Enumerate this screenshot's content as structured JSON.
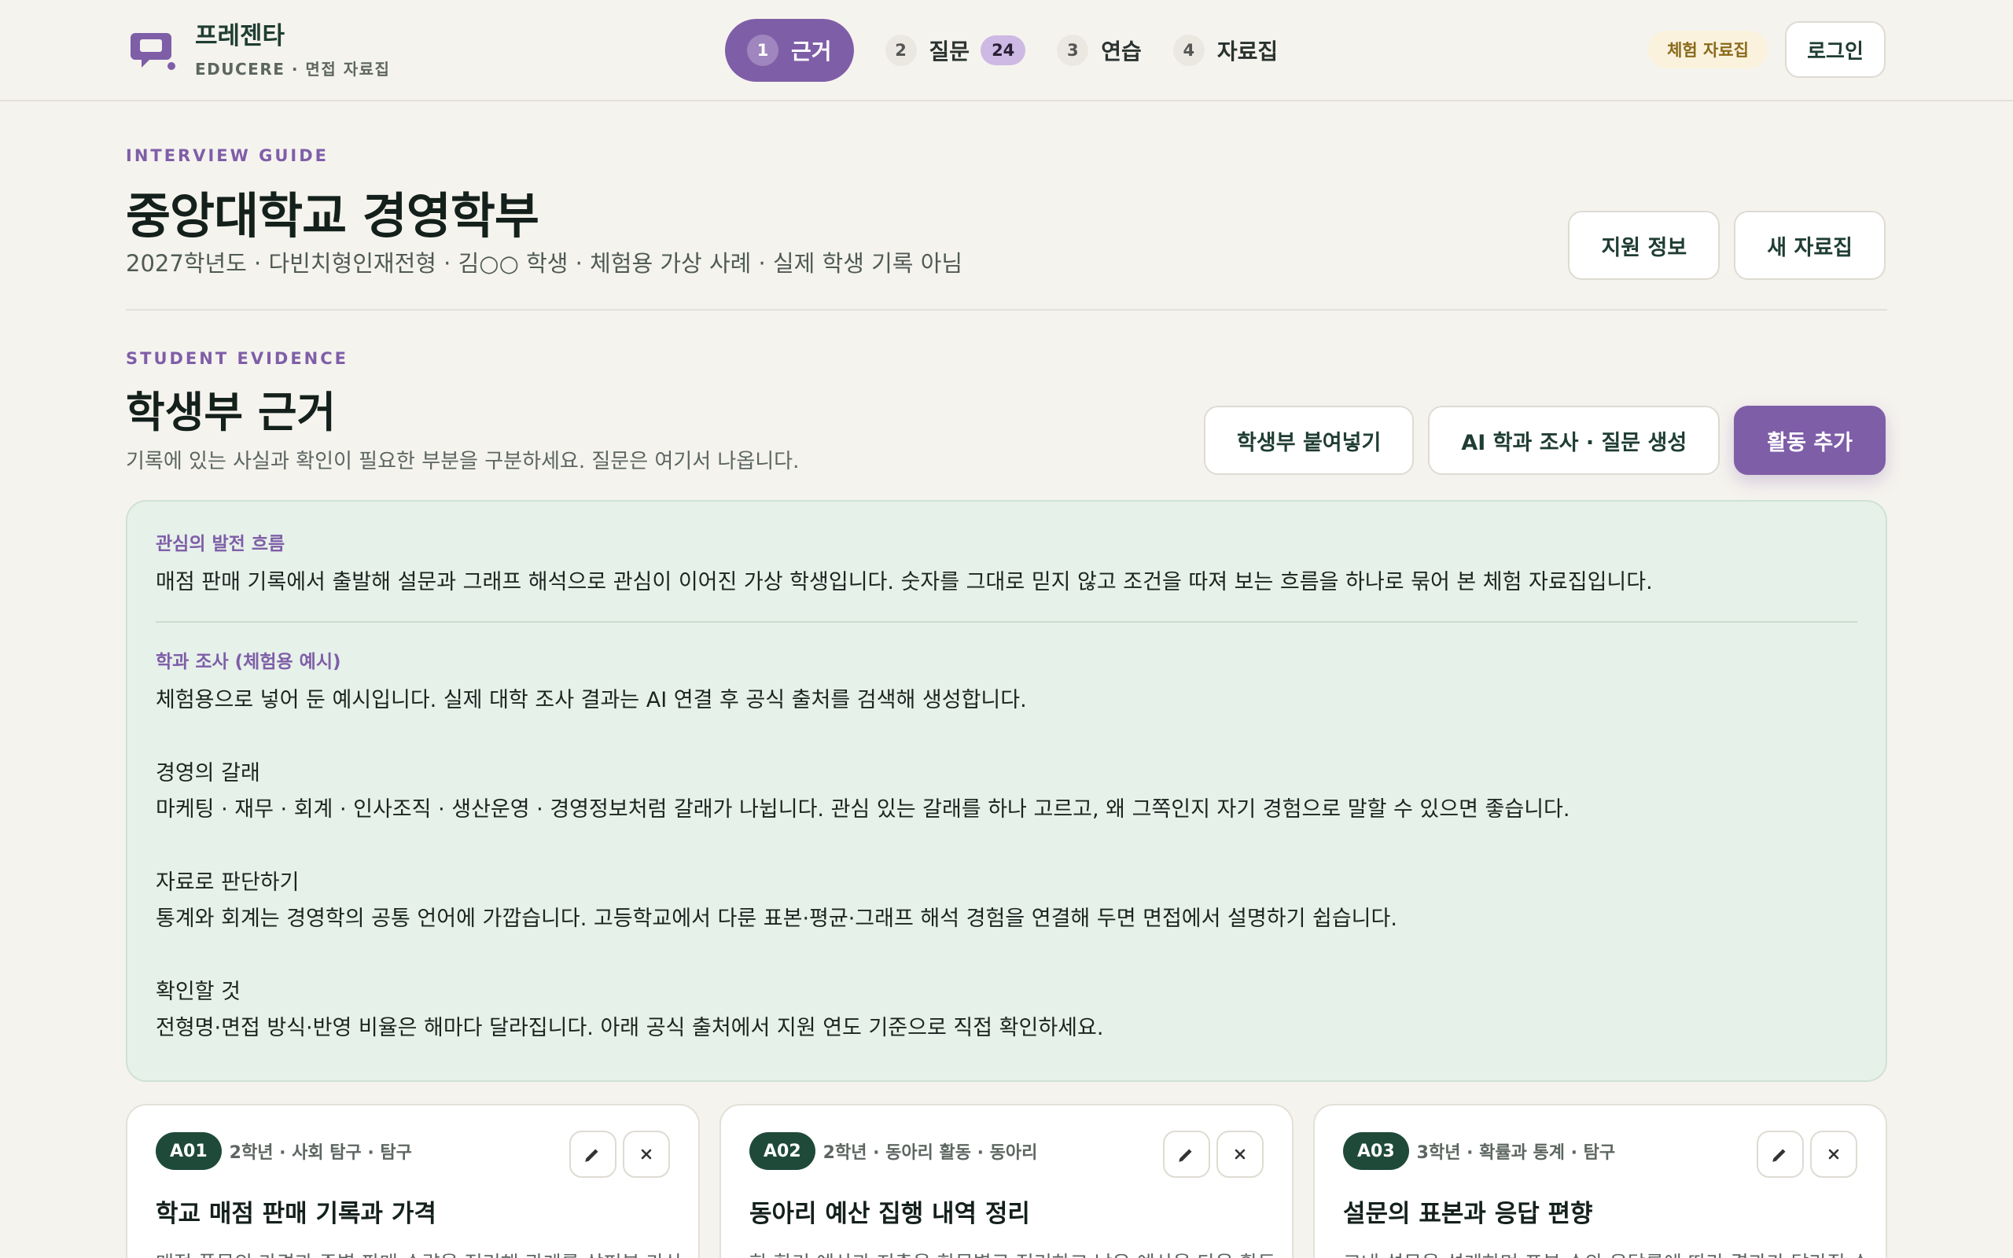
{
  "brand": {
    "name": "프레젠타",
    "subtitle": "EDUCERE · 면접 자료집",
    "accent": "#7f5ea8",
    "logo_icon": "chat-bubble-icon"
  },
  "steps": [
    {
      "num": "1",
      "label": "근거",
      "active": true
    },
    {
      "num": "2",
      "label": "질문",
      "count": "24"
    },
    {
      "num": "3",
      "label": "연습"
    },
    {
      "num": "4",
      "label": "자료집"
    }
  ],
  "top_right": {
    "demo_badge": "체험 자료집",
    "login": "로그인"
  },
  "header": {
    "eyebrow": "INTERVIEW GUIDE",
    "title": "중앙대학교 경영학부",
    "subtitle": "2027학년도 · 다빈치형인재전형 · 김○○ 학생 · 체험용 가상 사례 · 실제 학생 기록 아님",
    "buttons": {
      "info": "지원 정보",
      "new": "새 자료집"
    }
  },
  "evidence": {
    "eyebrow": "STUDENT EVIDENCE",
    "title": "학생부 근거",
    "subtitle": "기록에 있는 사실과 확인이 필요한 부분을 구분하세요. 질문은 여기서 나옵니다.",
    "buttons": {
      "paste": "학생부 붙여넣기",
      "ai": "AI 학과 조사 · 질문 생성",
      "add": "활동 추가"
    }
  },
  "panel": {
    "flow_label": "관심의 발전 흐름",
    "flow_text": "매점 판매 기록에서 출발해 설문과 그래프 해석으로 관심이 이어진 가상 학생입니다. 숫자를 그대로 믿지 않고 조건을 따져 보는 흐름을 하나로 묶어 본 체험 자료집입니다.",
    "research_label": "학과 조사 (체험용 예시)",
    "research_intro": "체험용으로 넣어 둔 예시입니다. 실제 대학 조사 결과는 AI 연결 후 공식 출처를 검색해 생성합니다.",
    "blocks": [
      {
        "title": "경영의 갈래",
        "text": "마케팅 · 재무 · 회계 · 인사조직 · 생산운영 · 경영정보처럼 갈래가 나뉩니다. 관심 있는 갈래를 하나 고르고, 왜 그쪽인지 자기 경험으로 말할 수 있으면 좋습니다."
      },
      {
        "title": "자료로 판단하기",
        "text": "통계와 회계는 경영학의 공통 언어에 가깝습니다. 고등학교에서 다룬 표본·평균·그래프 해석 경험을 연결해 두면 면접에서 설명하기 쉽습니다."
      },
      {
        "title": "확인할 것",
        "text": "전형명·면접 방식·반영 비율은 해마다 달라집니다. 아래 공식 출처에서 지원 연도 기준으로 직접 확인하세요."
      }
    ]
  },
  "cards": [
    {
      "id": "A01",
      "meta": "2학년 · 사회 탐구 · 탐구",
      "title": "학교 매점 판매 기록과 가격",
      "desc": "매점 품목의 가격과 주별 판매 수량을 정리해 관계를 살펴본 가상"
    },
    {
      "id": "A02",
      "meta": "2학년 · 동아리 활동 · 동아리",
      "title": "동아리 예산 집행 내역 정리",
      "desc": "한 학기 예산과 지출을 항목별로 정리하고 남은 예산을 다음 활동"
    },
    {
      "id": "A03",
      "meta": "3학년 · 확률과 통계 · 탐구",
      "title": "설문의 표본과 응답 편향",
      "desc": "교내 설문을 설계하며 표본 수와 응답률에 따라 결과가 달라질 수"
    }
  ],
  "colors": {
    "background": "#f5f3ee",
    "accent": "#7f5ea8",
    "panel_bg": "#e6f1ea",
    "card_id_bg": "#1f4a3a",
    "badge_bg": "#faf2dc"
  }
}
